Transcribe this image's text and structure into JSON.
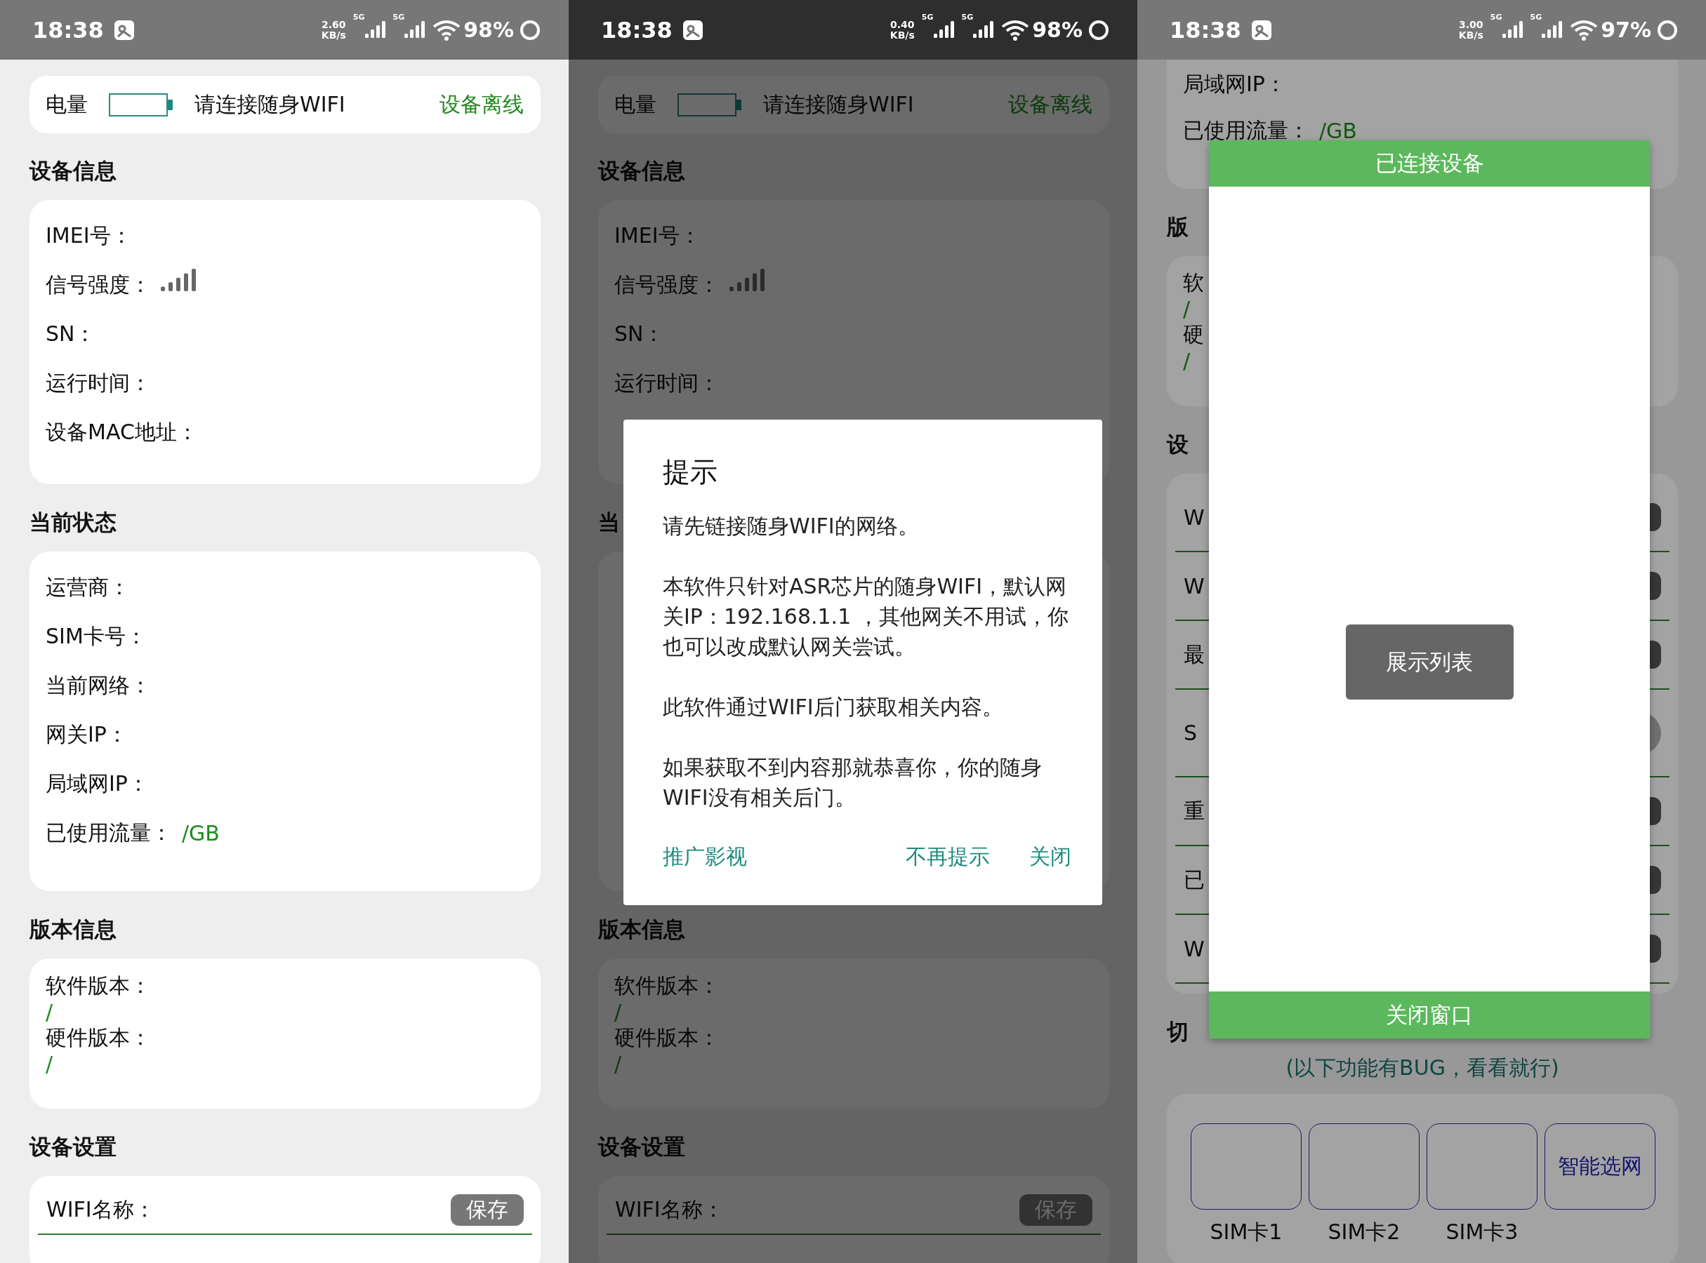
{
  "panels": [
    {
      "kind": "main",
      "dimmed": false,
      "status_bar": {
        "time": "18:38",
        "speed": "2.60",
        "speed_unit": "KB/s",
        "network_1": "5G",
        "network_2": "5G",
        "battery": "98%"
      },
      "header": {
        "battery_label": "电量",
        "message": "请连接随身WIFI",
        "status": "设备离线"
      },
      "sections": [
        {
          "kind": "info",
          "title": "设备信息",
          "rows": [
            {
              "label": "IMEI号："
            },
            {
              "label": "信号强度：",
              "signal": true
            },
            {
              "label": "SN："
            },
            {
              "label": "运行时间："
            },
            {
              "label": "设备MAC地址："
            }
          ]
        },
        {
          "kind": "status",
          "title": "当前状态",
          "rows": [
            {
              "label": "运营商："
            },
            {
              "label": "SIM卡号："
            },
            {
              "label": "当前网络："
            },
            {
              "label": "网关IP："
            },
            {
              "label": "局域网IP："
            },
            {
              "label": "已使用流量：",
              "value": "/GB"
            }
          ]
        },
        {
          "kind": "version",
          "title": "版本信息",
          "rows": [
            {
              "label": "软件版本："
            },
            {
              "value": "/"
            },
            {
              "label": "硬件版本："
            },
            {
              "value": "/"
            }
          ]
        },
        {
          "kind": "settings",
          "title": "设备设置",
          "rows": [
            {
              "label": "WIFI名称：",
              "button": "保存"
            }
          ]
        }
      ]
    },
    {
      "kind": "main",
      "dimmed": true,
      "status_bar": {
        "time": "18:38",
        "speed": "0.40",
        "speed_unit": "KB/s",
        "network_1": "5G",
        "network_2": "5G",
        "battery": "98%"
      },
      "header": {
        "battery_label": "电量",
        "message": "请连接随身WIFI",
        "status": "设备离线"
      },
      "sections": [
        {
          "kind": "info",
          "title": "设备信息",
          "rows": [
            {
              "label": "IMEI号："
            },
            {
              "label": "信号强度：",
              "signal": true
            },
            {
              "label": "SN："
            },
            {
              "label": "运行时间："
            }
          ]
        },
        {
          "kind": "status",
          "title": "当"
        },
        {
          "kind": "version",
          "title": "版本信息",
          "rows": [
            {
              "label": "软件版本："
            },
            {
              "value": "/"
            },
            {
              "label": "硬件版本："
            },
            {
              "value": "/"
            }
          ]
        },
        {
          "kind": "settings",
          "title": "设备设置",
          "rows": [
            {
              "label": "WIFI名称：",
              "button": "保存"
            }
          ]
        }
      ],
      "dialog": {
        "kind": "notice",
        "title": "提示",
        "paragraphs": [
          "请先链接随身WIFI的网络。",
          "本软件只针对ASR芯片的随身WIFI，默认网关IP：192.168.1.1 ，其他网关不用试，你也可以改成默认网关尝试。",
          "此软件通过WIFI后门获取相关内容。",
          "如果获取不到内容那就恭喜你，你的随身WIFI没有相关后门。"
        ],
        "buttons": [
          {
            "label": "推广影视"
          },
          {
            "label": "不再提示"
          },
          {
            "label": "关闭"
          }
        ]
      }
    },
    {
      "kind": "scrolled",
      "dimmed": true,
      "status_bar": {
        "time": "18:38",
        "speed": "3.00",
        "speed_unit": "KB/s",
        "network_1": "5G",
        "network_2": "5G",
        "battery": "97%"
      },
      "sections": [
        {
          "kind": "tail",
          "rows": [
            {
              "label": "局域网IP："
            },
            {
              "label": "已使用流量：",
              "value": "/GB"
            }
          ]
        },
        {
          "kind": "version",
          "title": "版",
          "rows": [
            {
              "label": "软"
            },
            {
              "value": "/"
            },
            {
              "label": "硬"
            },
            {
              "value": "/"
            }
          ]
        },
        {
          "kind": "toggles",
          "title": "设",
          "rows": [
            {
              "label": "W",
              "kind": "button"
            },
            {
              "label": "W",
              "kind": "button"
            },
            {
              "label": "最",
              "kind": "button"
            },
            {
              "label": "S",
              "kind": "switch",
              "on": false
            },
            {
              "label": "重",
              "kind": "button"
            },
            {
              "label": "已",
              "kind": "button"
            },
            {
              "label": "W",
              "kind": "button"
            }
          ]
        },
        {
          "kind": "sims",
          "title": "切",
          "note": "(以下功能有BUG，看看就行)",
          "cards": [
            {
              "label": "SIM卡1"
            },
            {
              "label": "SIM卡2"
            },
            {
              "label": "SIM卡3"
            },
            {
              "text": "智能选网"
            }
          ]
        }
      ],
      "dialog": {
        "kind": "list",
        "title": "已连接设备",
        "button": "展示列表",
        "footer": "关闭窗口"
      }
    }
  ]
}
